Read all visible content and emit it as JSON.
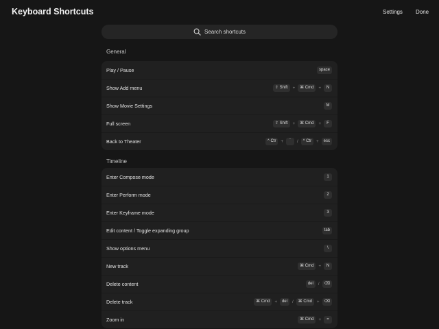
{
  "header": {
    "title": "Keyboard Shortcuts",
    "settings_label": "Settings",
    "done_label": "Done"
  },
  "search": {
    "placeholder": "Search shortcuts"
  },
  "sections": [
    {
      "title": "General",
      "rows": [
        {
          "label": "Play / Pause",
          "keys": [
            {
              "type": "key",
              "text": "space"
            }
          ]
        },
        {
          "label": "Show Add menu",
          "keys": [
            {
              "type": "key",
              "text": "⇧ Shift"
            },
            {
              "type": "sep",
              "text": "+"
            },
            {
              "type": "key",
              "text": "⌘ Cmd"
            },
            {
              "type": "sep",
              "text": "+"
            },
            {
              "type": "key",
              "text": "N"
            }
          ]
        },
        {
          "label": "Show Movie Settings",
          "keys": [
            {
              "type": "key",
              "text": "M"
            }
          ]
        },
        {
          "label": "Full screen",
          "keys": [
            {
              "type": "key",
              "text": "⇧ Shift"
            },
            {
              "type": "sep",
              "text": "+"
            },
            {
              "type": "key",
              "text": "⌘ Cmd"
            },
            {
              "type": "sep",
              "text": "+"
            },
            {
              "type": "key",
              "text": "F"
            }
          ]
        },
        {
          "label": "Back to Theater",
          "keys": [
            {
              "type": "key",
              "text": "^ Ctr"
            },
            {
              "type": "sep",
              "text": "+"
            },
            {
              "type": "key",
              "text": "`"
            },
            {
              "type": "sep",
              "text": "/"
            },
            {
              "type": "key",
              "text": "^ Ctr"
            },
            {
              "type": "sep",
              "text": "+"
            },
            {
              "type": "key",
              "text": "esc"
            }
          ]
        }
      ]
    },
    {
      "title": "Timeline",
      "rows": [
        {
          "label": "Enter Compose mode",
          "keys": [
            {
              "type": "key",
              "text": "1"
            }
          ]
        },
        {
          "label": "Enter Perform mode",
          "keys": [
            {
              "type": "key",
              "text": "2"
            }
          ]
        },
        {
          "label": "Enter Keyframe mode",
          "keys": [
            {
              "type": "key",
              "text": "3"
            }
          ]
        },
        {
          "label": "Edit content / Toggle expanding group",
          "keys": [
            {
              "type": "key",
              "text": "tab"
            }
          ]
        },
        {
          "label": "Show options menu",
          "keys": [
            {
              "type": "key",
              "text": "\\"
            }
          ]
        },
        {
          "label": "New track",
          "keys": [
            {
              "type": "key",
              "text": "⌘ Cmd"
            },
            {
              "type": "sep",
              "text": "+"
            },
            {
              "type": "key",
              "text": "N"
            }
          ]
        },
        {
          "label": "Delete content",
          "keys": [
            {
              "type": "key",
              "text": "del"
            },
            {
              "type": "sep",
              "text": "/"
            },
            {
              "type": "key",
              "text": "⌫"
            }
          ]
        },
        {
          "label": "Delete track",
          "keys": [
            {
              "type": "key",
              "text": "⌘ Cmd"
            },
            {
              "type": "sep",
              "text": "+"
            },
            {
              "type": "key",
              "text": "del"
            },
            {
              "type": "sep",
              "text": "/"
            },
            {
              "type": "key",
              "text": "⌘ Cmd"
            },
            {
              "type": "sep",
              "text": "+"
            },
            {
              "type": "key",
              "text": "⌫"
            }
          ]
        },
        {
          "label": "Zoom in",
          "keys": [
            {
              "type": "key",
              "text": "⌘ Cmd"
            },
            {
              "type": "sep",
              "text": "+"
            },
            {
              "type": "key",
              "text": "="
            }
          ]
        }
      ]
    }
  ]
}
